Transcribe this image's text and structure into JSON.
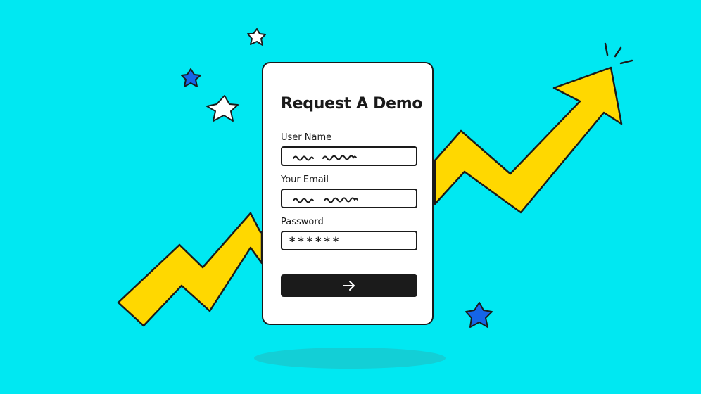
{
  "form": {
    "title": "Request A Demo",
    "fields": [
      {
        "label": "User Name"
      },
      {
        "label": "Your Email"
      },
      {
        "label": "Password",
        "value": "******"
      }
    ]
  },
  "colors": {
    "background": "#00e8f2",
    "arrow": "#ffd800",
    "star_blue": "#1565e8",
    "star_white": "#ffffff",
    "button": "#1b1b1b",
    "shadow": "#13cfd6"
  },
  "icons": {
    "submit": "arrow-right-icon",
    "decoration": "star-icon"
  }
}
